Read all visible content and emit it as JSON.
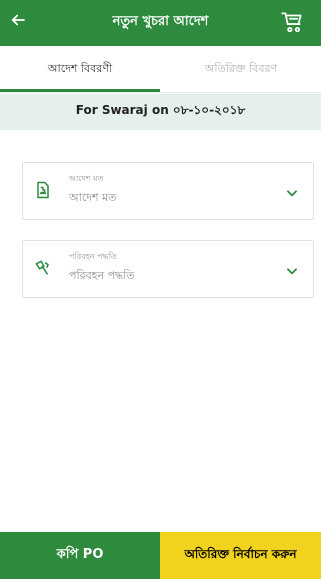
{
  "header": {
    "title": "নতুন খুচরা আদেশ",
    "back_icon": "arrow-left-icon",
    "cart_icon": "shopping-cart-icon"
  },
  "tabs": [
    {
      "label": "আদেশ বিবরণী",
      "active": true
    },
    {
      "label": "অতিরিক্ত বিবরণ",
      "active": false
    }
  ],
  "order_for_text": "For Swaraj on ০৮-১০-২০১৮",
  "fields": [
    {
      "label": "আদেশ মত",
      "value": "আদেশ মত",
      "icon": "order-document-icon"
    },
    {
      "label": "পরিবহন পদ্ধতি",
      "value": "পরিবহন পদ্ধতি",
      "icon": "fuel-pump-icon"
    }
  ],
  "bottom": {
    "copy_po_label": "কপি PO",
    "extra_select_label": "অতিরিক্ত নির্বাচন করুন"
  },
  "colors": {
    "primary_green": "#2e8b3e",
    "band_bg": "#e6f0ea",
    "yellow": "#f1d21d"
  }
}
